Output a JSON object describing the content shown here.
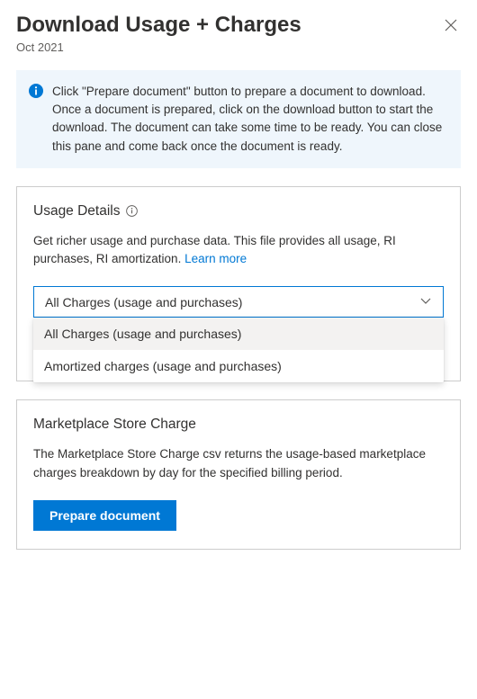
{
  "header": {
    "title": "Download Usage + Charges",
    "subtitle": "Oct 2021"
  },
  "info": {
    "text": "Click \"Prepare document\" button to prepare a document to download. Once a document is prepared, click on the download button to start the download. The document can take some time to be ready. You can close this pane and come back once the document is ready."
  },
  "usageDetails": {
    "title": "Usage Details",
    "desc": "Get richer usage and purchase data. This file provides all usage, RI purchases, RI amortization. ",
    "learnMore": "Learn more",
    "selected": "All Charges (usage and purchases)",
    "options": [
      "All Charges (usage and purchases)",
      "Amortized charges (usage and purchases)"
    ]
  },
  "marketplace": {
    "title": "Marketplace Store Charge",
    "desc": "The Marketplace Store Charge csv returns the usage-based marketplace charges breakdown by day for the specified billing period.",
    "button": "Prepare document"
  }
}
